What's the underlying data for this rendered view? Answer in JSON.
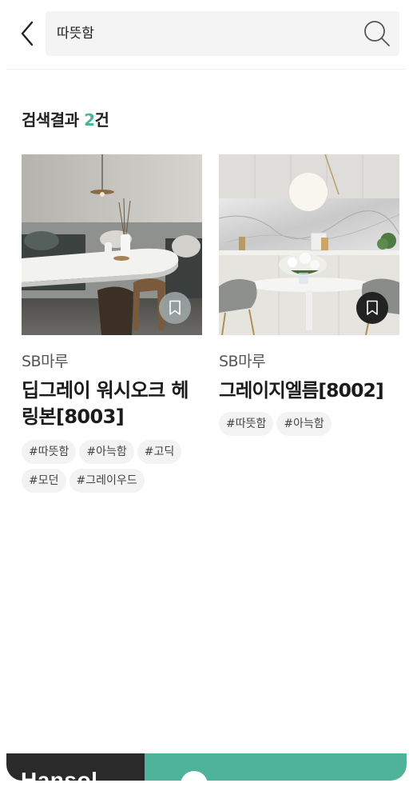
{
  "header": {
    "search_value": "따뜻함",
    "back_icon": "chevron-left-icon",
    "search_icon": "search-icon"
  },
  "results": {
    "label_prefix": "검색결과 ",
    "count": "2",
    "label_suffix": "건",
    "accent_color": "#4ab39b"
  },
  "products": [
    {
      "brand": "SB마루",
      "name": "딥그레이 워시오크 헤링본[8003]",
      "tags": [
        "#따뜻함",
        "#아늑함",
        "#고딕",
        "#모던",
        "#그레이우드"
      ],
      "bookmark_icon": "bookmark-icon"
    },
    {
      "brand": "SB마루",
      "name": "그레이지엘름[8002]",
      "tags": [
        "#따뜻함",
        "#아늑함"
      ],
      "bookmark_icon": "bookmark-icon"
    }
  ],
  "bottom_bar": {
    "logo": "Hansol",
    "right_label": ""
  },
  "colors": {
    "accent": "#4fb39a",
    "dark": "#2a2a2a"
  }
}
